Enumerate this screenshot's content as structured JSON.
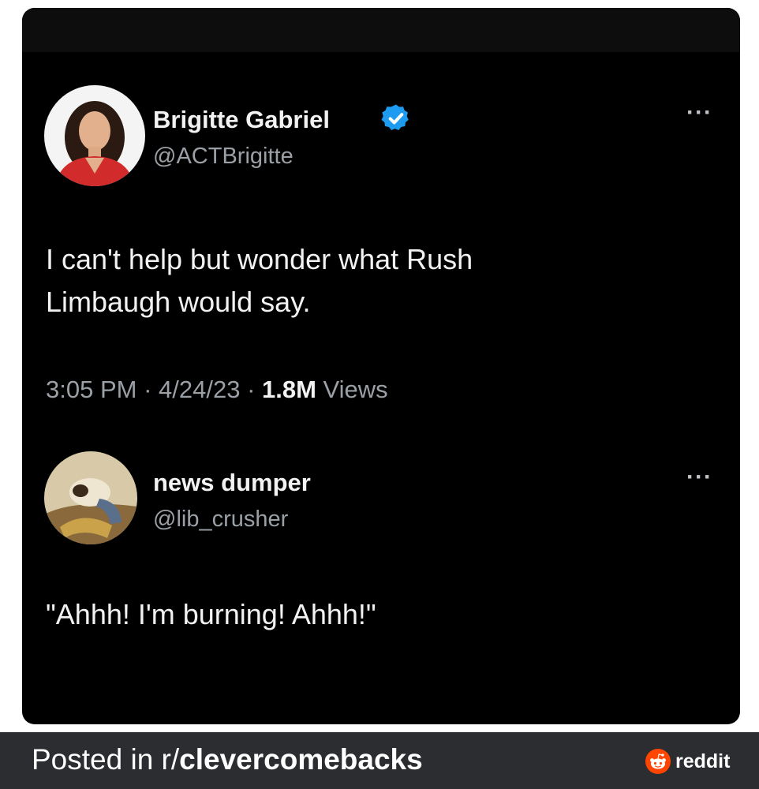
{
  "tweet": {
    "author_name": "Brigitte Gabriel",
    "author_handle": "@ACTBrigitte",
    "more_label": "···",
    "text_line1": "I can't help but wonder what Rush",
    "text_line2": "Limbaugh would say.",
    "time": "3:05 PM",
    "sep1": " · ",
    "date": "4/24/23",
    "sep2": " · ",
    "views_count": "1.8M",
    "views_label": " Views",
    "verified_icon": "verified-check-icon"
  },
  "reply": {
    "author_name": "news dumper",
    "author_handle": "@lib_crusher",
    "more_label": "···",
    "text": "\"Ahhh! I'm burning! Ahhh!\""
  },
  "footer": {
    "posted_prefix": "Posted in r/",
    "subreddit": "clevercomebacks",
    "brand": "reddit"
  },
  "colors": {
    "background": "#000000",
    "verified_blue": "#1d9bf0",
    "muted_text": "#9aa0a5",
    "footer_bg": "#2b2d31",
    "reddit_orange": "#ff4500"
  }
}
